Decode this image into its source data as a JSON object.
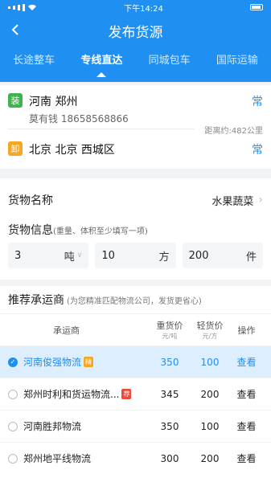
{
  "status": {
    "time": "下午14:24"
  },
  "header": {
    "title": "发布货源"
  },
  "tabs": [
    "长途整车",
    "专线直达",
    "同城包车",
    "国际运输"
  ],
  "route": {
    "load_tag": "装",
    "load_city": "河南 郑州",
    "load_contact": "莫有钱  18658568866",
    "load_chang": "常",
    "distance": "距离约:482公里",
    "unload_tag": "卸",
    "unload_city": "北京 北京 西城区",
    "unload_chang": "常"
  },
  "goods": {
    "name_label": "货物名称",
    "name_value": "水果蔬菜",
    "info_label": "货物信息",
    "info_note": "(重量、体积至少填写一项)",
    "weight_value": "3",
    "weight_unit": "吨",
    "volume_value": "10",
    "volume_unit": "方",
    "count_value": "200",
    "count_unit": "件"
  },
  "carriers": {
    "title": "推荐承运商",
    "note": "(为您精准匹配物流公司，发货更省心)",
    "headers": {
      "name": "承运商",
      "heavy": "重货价",
      "heavy_unit": "元/吨",
      "light": "轻货价",
      "light_unit": "元/方",
      "action": "操作"
    },
    "rows": [
      {
        "name": "河南俊强物流",
        "badge": "精",
        "heavy": "350",
        "light": "100",
        "action": "查看"
      },
      {
        "name": "郑州时利和货运物流...",
        "badge": "荐",
        "heavy": "345",
        "light": "200",
        "action": "查看"
      },
      {
        "name": "河南胜邦物流",
        "badge": "",
        "heavy": "350",
        "light": "100",
        "action": "查看"
      },
      {
        "name": "郑州地平线物流",
        "badge": "",
        "heavy": "300",
        "light": "200",
        "action": "查看"
      }
    ]
  },
  "colors": {
    "primary": "#1f8ff2",
    "load_tag": "#3fb34f",
    "unload_tag": "#f5a623"
  }
}
